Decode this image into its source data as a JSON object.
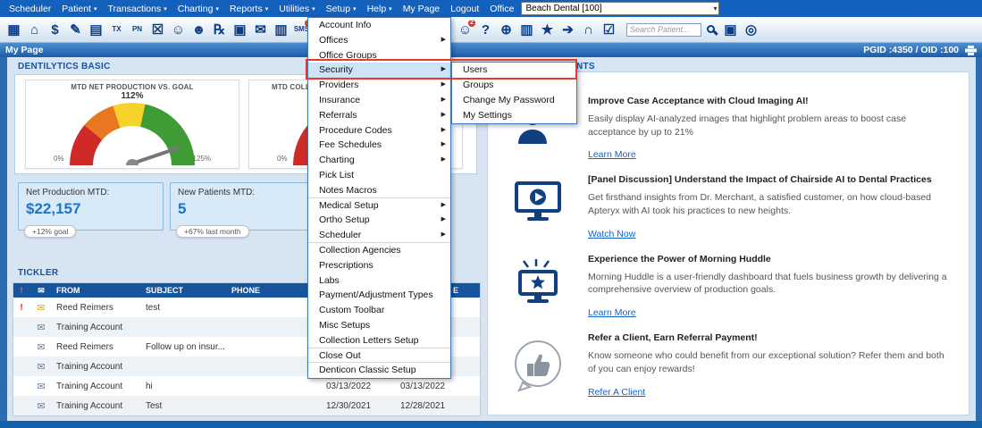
{
  "colors": {
    "accent": "#1565c0",
    "alert_red": "#e0392b",
    "gauge_segments": [
      "#cf2a27",
      "#e87722",
      "#f6d32b",
      "#3f9c35"
    ]
  },
  "menubar": {
    "items": [
      {
        "label": "Scheduler",
        "arrow": ""
      },
      {
        "label": "Patient",
        "arrow": "▾"
      },
      {
        "label": "Transactions",
        "arrow": "▾"
      },
      {
        "label": "Charting",
        "arrow": "▾"
      },
      {
        "label": "Reports",
        "arrow": "▾"
      },
      {
        "label": "Utilities",
        "arrow": "▾"
      },
      {
        "label": "Setup",
        "arrow": "▾"
      },
      {
        "label": "Help",
        "arrow": "▾"
      },
      {
        "label": "My Page",
        "arrow": ""
      },
      {
        "label": "Logout",
        "arrow": ""
      },
      {
        "label": "Office",
        "arrow": ""
      }
    ],
    "office_select": {
      "value": "Beach Dental [100]",
      "arrow": "▾"
    }
  },
  "toolbar": {
    "left_icons": [
      {
        "glyph": "▦",
        "name": "scheduler-icon"
      },
      {
        "glyph": "⌂",
        "name": "home-icon"
      },
      {
        "glyph": "$",
        "name": "payments-icon"
      },
      {
        "glyph": "✎",
        "name": "charting-icon"
      },
      {
        "glyph": "▤",
        "name": "documents-icon"
      },
      {
        "glyph": "TX",
        "name": "treatment-plan-icon",
        "cls": "txt"
      },
      {
        "glyph": "PN",
        "name": "progress-notes-icon",
        "cls": "txt"
      },
      {
        "glyph": "☒",
        "name": "cancel-appointment-icon"
      },
      {
        "glyph": "☺",
        "name": "add-patient-icon"
      },
      {
        "glyph": "☻",
        "name": "patient-history-icon"
      },
      {
        "glyph": "℞",
        "name": "prescriptions-icon"
      },
      {
        "glyph": "▣",
        "name": "print-icon"
      },
      {
        "glyph": "✉",
        "name": "mail-icon"
      },
      {
        "glyph": "▥",
        "name": "reports-icon"
      },
      {
        "glyph": "SMS",
        "name": "sms-icon",
        "cls": "txt",
        "badge": "1"
      }
    ],
    "right_icons": [
      {
        "glyph": "☺",
        "name": "patient-info-icon",
        "badge": "2"
      },
      {
        "glyph": "?",
        "name": "help-icon"
      },
      {
        "glyph": "⊕",
        "name": "globe-icon"
      },
      {
        "glyph": "▥",
        "name": "analytics-icon"
      },
      {
        "glyph": "★",
        "name": "favorites-icon"
      },
      {
        "glyph": "➔",
        "name": "referral-icon"
      },
      {
        "glyph": "∩",
        "name": "tooth-chart-icon"
      },
      {
        "glyph": "☑",
        "name": "tasks-icon"
      }
    ],
    "trail_icons": [
      {
        "glyph": "▣",
        "name": "window-icon"
      },
      {
        "glyph": "◎",
        "name": "sync-icon"
      }
    ],
    "search": {
      "placeholder": "Search Patient..."
    }
  },
  "mypage_bar": {
    "title": "My Page",
    "ids": "PGID :4350 / OID :100"
  },
  "dentilytics": {
    "label": "DENTILYTICS BASIC",
    "gauge1": {
      "title": "MTD NET PRODUCTION VS. GOAL",
      "value": "112%",
      "min": "0%",
      "max": "125%",
      "percent": 112,
      "min_val": 0,
      "max_val": 125
    },
    "gauge2": {
      "title": "MTD COLL",
      "min": "0%"
    },
    "stats": [
      {
        "label": "Net Production MTD:",
        "value": "$22,157",
        "pill": "+12% goal"
      },
      {
        "label": "New Patients MTD:",
        "value": "5",
        "pill": "+67% last month"
      }
    ]
  },
  "tickler": {
    "label": "TICKLER",
    "columns": {
      "alert": "!",
      "env": "✉",
      "from": "FROM",
      "subject": "SUBJECT",
      "phone": "PHONE",
      "date1": "",
      "date2": "E"
    },
    "rows": [
      {
        "alert": "!",
        "from": "Reed Reimers",
        "subject": "test",
        "phone": "",
        "date1": "",
        "date2": "",
        "cls": "mail"
      },
      {
        "alert": "",
        "from": "Training Account",
        "subject": "",
        "phone": "",
        "date1": "",
        "date2": "",
        "cls": "office"
      },
      {
        "alert": "",
        "from": "Reed Reimers",
        "subject": "Follow up on insur...",
        "phone": "",
        "date1": "",
        "date2": "",
        "cls": "office"
      },
      {
        "alert": "",
        "from": "Training Account",
        "subject": "",
        "phone": "",
        "date1": "",
        "date2": "",
        "cls": "office"
      },
      {
        "alert": "",
        "from": "Training Account",
        "subject": "hi",
        "phone": "",
        "date1": "03/13/2022",
        "date2": "03/13/2022",
        "cls": "office"
      },
      {
        "alert": "",
        "from": "Training Account",
        "subject": "Test",
        "phone": "",
        "date1": "12/30/2021",
        "date2": "12/28/2021",
        "cls": "office"
      }
    ]
  },
  "setup_menu": {
    "items": [
      {
        "label": "Account Info",
        "arrow": ""
      },
      {
        "label": "Offices",
        "arrow": "▶"
      },
      {
        "label": "Office Groups",
        "arrow": ""
      },
      {
        "label": "Security",
        "arrow": "▶",
        "cls": "active sep"
      },
      {
        "label": "Providers",
        "arrow": "▶"
      },
      {
        "label": "Insurance",
        "arrow": "▶"
      },
      {
        "label": "Referrals",
        "arrow": "▶"
      },
      {
        "label": "Procedure Codes",
        "arrow": "▶"
      },
      {
        "label": "Fee Schedules",
        "arrow": "▶"
      },
      {
        "label": "Charting",
        "arrow": "▶"
      },
      {
        "label": "Pick List",
        "arrow": ""
      },
      {
        "label": "Notes Macros",
        "arrow": "",
        "cls": "sep"
      },
      {
        "label": "Medical Setup",
        "arrow": "▶"
      },
      {
        "label": "Ortho Setup",
        "arrow": "▶"
      },
      {
        "label": "Scheduler",
        "arrow": "▶",
        "cls": "sep"
      },
      {
        "label": "Collection Agencies",
        "arrow": ""
      },
      {
        "label": "Prescriptions",
        "arrow": ""
      },
      {
        "label": "Labs",
        "arrow": ""
      },
      {
        "label": "Payment/Adjustment Types",
        "arrow": ""
      },
      {
        "label": "Custom Toolbar",
        "arrow": ""
      },
      {
        "label": "Misc Setups",
        "arrow": ""
      },
      {
        "label": "Collection Letters Setup",
        "arrow": "",
        "cls": "sep"
      },
      {
        "label": "Close Out",
        "arrow": "",
        "cls": "sep"
      },
      {
        "label": "Denticon Classic Setup",
        "arrow": ""
      }
    ]
  },
  "security_submenu": {
    "items": [
      {
        "label": "Users",
        "arrow": ""
      },
      {
        "label": "Groups",
        "arrow": ""
      },
      {
        "label": "Change My Password",
        "arrow": ""
      },
      {
        "label": "My Settings",
        "arrow": ""
      }
    ]
  },
  "announcements": {
    "header_fragment": "NTS",
    "items": [
      {
        "title": "Improve Case Acceptance with Cloud Imaging AI!",
        "body": "Easily display AI-analyzed images that highlight problem areas to boost case acceptance by up to 21%",
        "link": "Learn More"
      },
      {
        "title": "[Panel Discussion] Understand the Impact of Chairside AI to Dental Practices",
        "body": "Get firsthand insights from Dr. Merchant, a satisfied customer, on how cloud-based Apteryx with AI took his practices to new heights.",
        "link": "Watch Now"
      },
      {
        "title": "Experience the Power of Morning Huddle",
        "body": "Morning Huddle is a user-friendly dashboard that fuels business growth by delivering a comprehensive overview of production goals.",
        "link": "Learn More"
      },
      {
        "title": "Refer a Client, Earn Referral Payment!",
        "body": "Know someone who could benefit from our exceptional solution? Refer them and both of you can enjoy rewards!",
        "link": "Refer A Client"
      }
    ]
  }
}
